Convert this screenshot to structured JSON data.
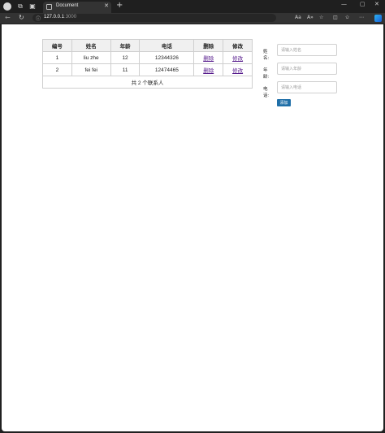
{
  "browser": {
    "tab_title": "Document",
    "url_host": "127.0.0.1",
    "url_port": ":3000",
    "reader_label": "A»"
  },
  "table": {
    "headers": [
      "编号",
      "姓名",
      "年龄",
      "电话",
      "删除",
      "修改"
    ],
    "rows": [
      {
        "id": "1",
        "name": "liu zhe",
        "age": "12",
        "phone": "12344326",
        "delete": "删除",
        "edit": "修改"
      },
      {
        "id": "2",
        "name": "fei fei",
        "age": "11",
        "phone": "12474465",
        "delete": "删除",
        "edit": "修改"
      }
    ],
    "footer": "共 2 个联系人"
  },
  "form": {
    "name_label": "姓名:",
    "name_placeholder": "请输入姓名",
    "age_label": "年龄:",
    "age_placeholder": "请输入年龄",
    "phone_label": "电话:",
    "phone_placeholder": "请输入电话",
    "add_button": "添加"
  },
  "colors": {
    "add_button": "#1f6fa8",
    "link": "#551a8b"
  }
}
